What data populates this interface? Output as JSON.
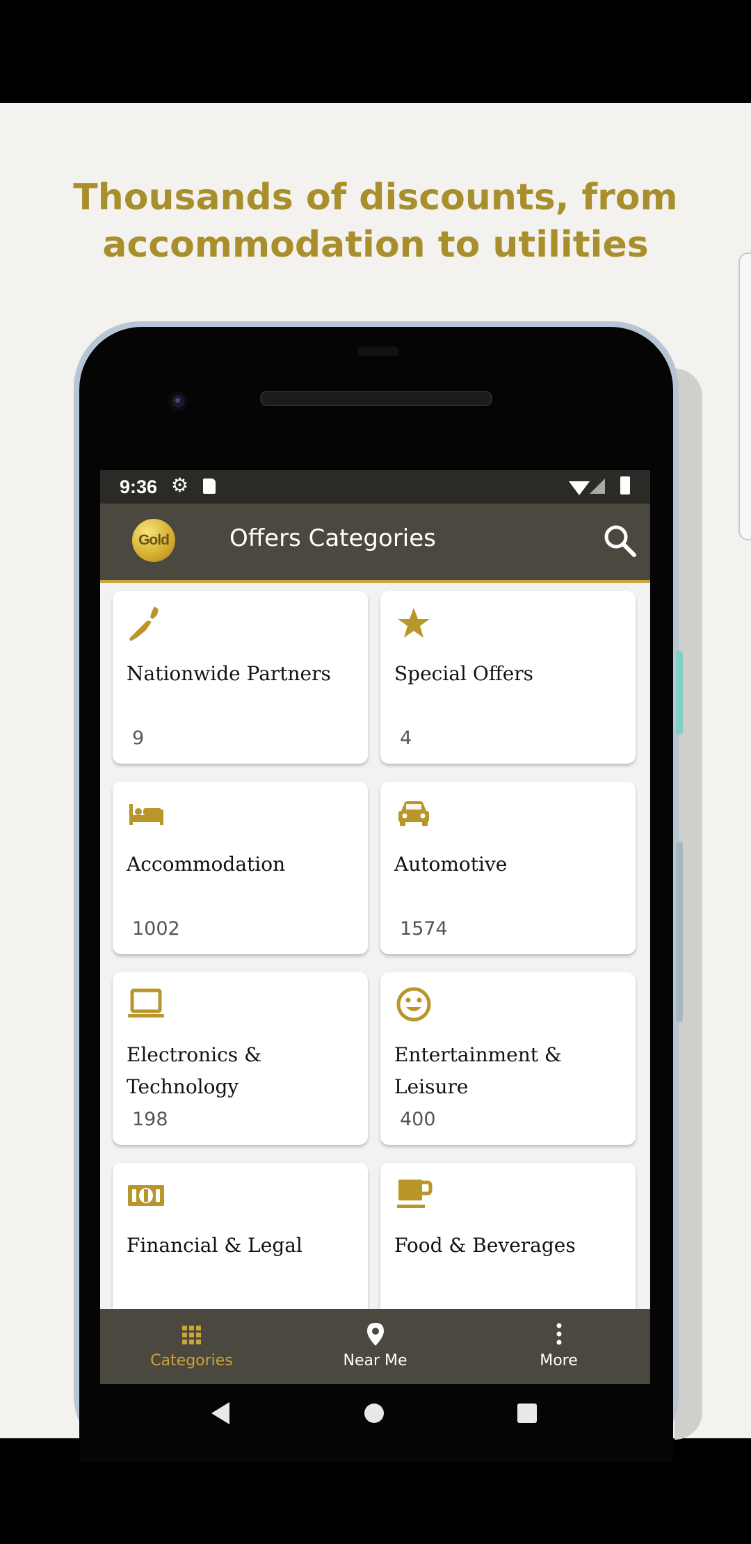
{
  "headline": {
    "line1": "Thousands of discounts, from",
    "line2": "accommodation to utilities"
  },
  "status_bar": {
    "time": "9:36",
    "icons": [
      "gear-icon",
      "sd-card-icon",
      "wifi-icon",
      "signal-icon",
      "battery-icon"
    ]
  },
  "app_bar": {
    "logo_text": "Gold",
    "title": "Offers Categories",
    "search_icon": "search-icon"
  },
  "categories": [
    {
      "title_line1": "Nationwide Partners",
      "title_line2": "",
      "count": "9",
      "icon": "new-zealand-map-icon"
    },
    {
      "title_line1": "Special Offers",
      "title_line2": "",
      "count": "4",
      "icon": "star-icon"
    },
    {
      "title_line1": "Accommodation",
      "title_line2": "",
      "count": "1002",
      "icon": "bed-icon"
    },
    {
      "title_line1": "Automotive",
      "title_line2": "",
      "count": "1574",
      "icon": "car-icon"
    },
    {
      "title_line1": "Electronics &",
      "title_line2": "Technology",
      "count": "198",
      "icon": "laptop-icon"
    },
    {
      "title_line1": "Entertainment &",
      "title_line2": "Leisure",
      "count": "400",
      "icon": "smiley-icon"
    },
    {
      "title_line1": "Financial & Legal",
      "title_line2": "",
      "count": "",
      "icon": "money-icon"
    },
    {
      "title_line1": "Food & Beverages",
      "title_line2": "",
      "count": "",
      "icon": "coffee-cup-icon"
    }
  ],
  "bottom_nav": [
    {
      "label": "Categories",
      "icon": "grid-icon",
      "active": true
    },
    {
      "label": "Near Me",
      "icon": "location-pin-icon",
      "active": false
    },
    {
      "label": "More",
      "icon": "more-vertical-icon",
      "active": false
    }
  ],
  "colors": {
    "gold_accent": "#a98e2c",
    "icon_gold": "#b8962a",
    "bar_dark": "#4a483f",
    "backdrop": "#f4f2ee"
  }
}
